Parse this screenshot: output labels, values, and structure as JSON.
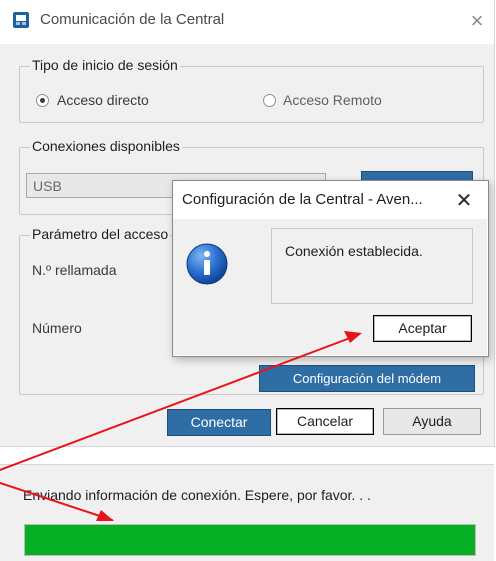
{
  "window": {
    "title": "Comunicación de la Central",
    "close_symbol": "×"
  },
  "login_type": {
    "legend": "Tipo de inicio de sesión",
    "options": [
      {
        "label": "Acceso directo",
        "selected": true
      },
      {
        "label": "Acceso Remoto",
        "selected": false
      }
    ]
  },
  "connections": {
    "legend": "Conexiones disponibles",
    "selected_value": "USB"
  },
  "parameters": {
    "legend": "Parámetro del acceso",
    "redial_label": "N.º rellamada",
    "number_label": "Número",
    "modem_button": "Configuración del módem"
  },
  "footer_buttons": {
    "connect": "Conectar",
    "cancel": "Cancelar",
    "help": "Ayuda"
  },
  "status": {
    "message": "Enviando información de conexión. Espere, por favor. . .",
    "progress_fraction": 1.0
  },
  "message_box": {
    "title": "Configuración de la Central - Aven...",
    "close_symbol": "✕",
    "text": "Conexión establecida.",
    "ok_label": "Aceptar",
    "icon": "info-icon"
  },
  "annotations": {
    "arrow_color": "#e8141c",
    "icons": [
      "app-icon",
      "info-icon",
      "red-arrow"
    ]
  },
  "colors": {
    "accent_button": "#2f6ea4",
    "progress_green": "#06b025"
  }
}
